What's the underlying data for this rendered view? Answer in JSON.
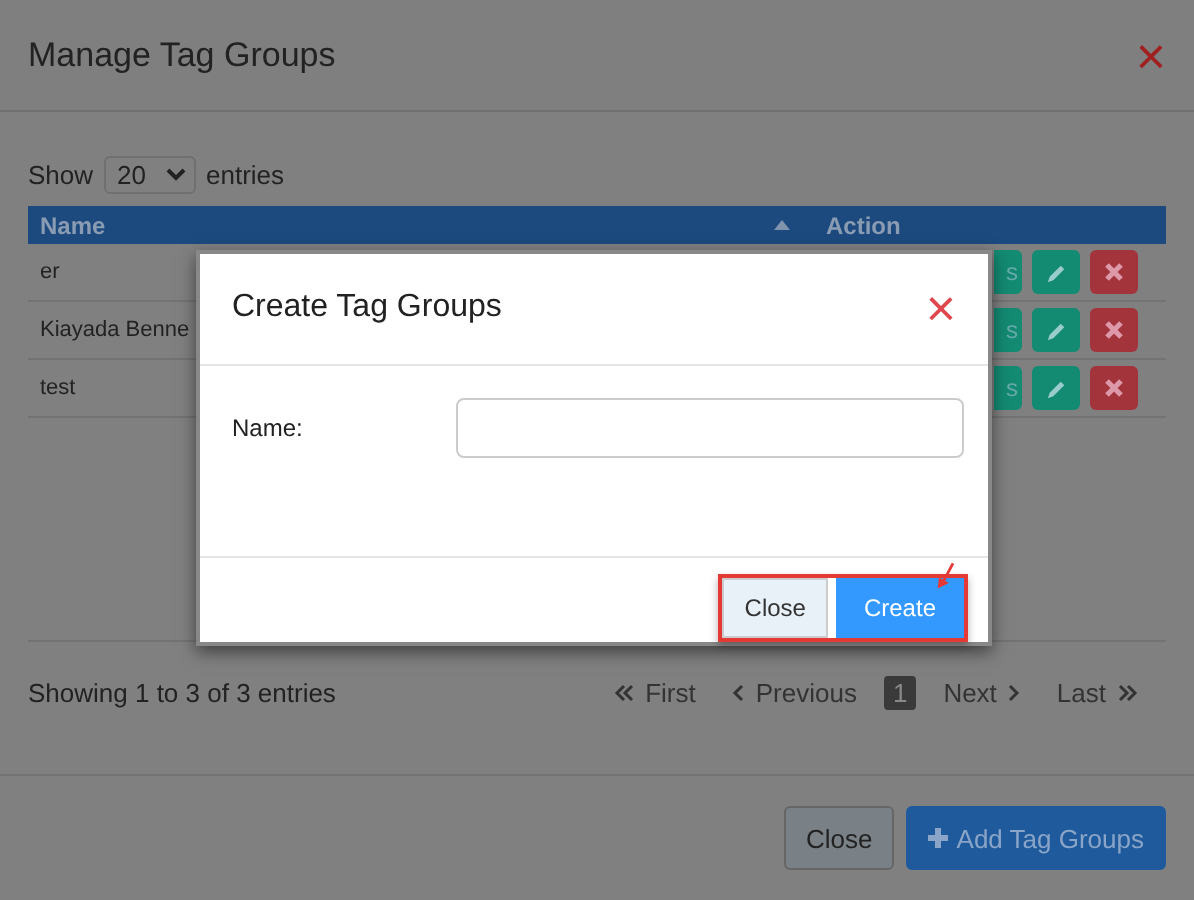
{
  "window": {
    "title": "Manage Tag Groups",
    "close": "×"
  },
  "length_menu": {
    "before": "Show",
    "value": "20",
    "after": "entries"
  },
  "table": {
    "columns": [
      {
        "label": "Name",
        "sorted": true
      },
      {
        "label": "Action",
        "sorted": false
      }
    ],
    "rows": [
      {
        "name": "er",
        "partial_label": "s"
      },
      {
        "name": "Kiayada Benne",
        "partial_label": "s"
      },
      {
        "name": "test",
        "partial_label": "s"
      }
    ]
  },
  "info": "Showing 1 to 3 of 3 entries",
  "pagination": [
    {
      "label": "First",
      "kind": "first",
      "selected": false
    },
    {
      "label": "Previous",
      "kind": "prev",
      "selected": false
    },
    {
      "label": "1",
      "kind": "page",
      "selected": true
    },
    {
      "label": "Next",
      "kind": "next",
      "selected": false
    },
    {
      "label": "Last",
      "kind": "last",
      "selected": false
    }
  ],
  "footer_buttons": [
    {
      "label": "Close",
      "kind": "secondary"
    },
    {
      "label": "Add Tag Groups",
      "kind": "primary"
    }
  ],
  "dialog": {
    "title": "Create Tag Groups",
    "close": "×",
    "field_label": "Name:",
    "buttons": [
      {
        "label": "Close",
        "kind": "secondary"
      },
      {
        "label": "Create",
        "kind": "primary"
      }
    ],
    "highlighted": true
  }
}
